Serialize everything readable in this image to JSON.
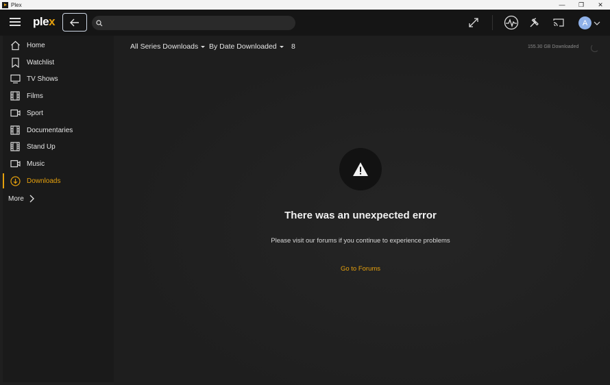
{
  "window": {
    "title": "Plex",
    "controls": [
      "minimize",
      "restore",
      "close"
    ]
  },
  "topbar": {
    "logo_text": "ple",
    "logo_accent": "x",
    "search": {
      "placeholder": "",
      "value": ""
    },
    "icons": [
      "menu-icon",
      "back-arrow-icon",
      "search-icon",
      "fullscreen-icon",
      "activity-icon",
      "settings-wrench-icon",
      "cast-icon",
      "chevron-down-icon"
    ],
    "avatar_letter": "A"
  },
  "sidebar": {
    "items": [
      {
        "label": "Home",
        "icon": "home-icon"
      },
      {
        "label": "Watchlist",
        "icon": "bookmark-icon"
      },
      {
        "label": "TV Shows",
        "icon": "tv-icon"
      },
      {
        "label": "Films",
        "icon": "film-icon"
      },
      {
        "label": "Sport",
        "icon": "video-camera-icon"
      },
      {
        "label": "Documentaries",
        "icon": "film-icon"
      },
      {
        "label": "Stand Up",
        "icon": "film-icon"
      },
      {
        "label": "Music",
        "icon": "video-camera-icon"
      },
      {
        "label": "Downloads",
        "icon": "download-icon",
        "active": true
      }
    ],
    "more_label": "More"
  },
  "toolbar": {
    "filter_label": "All Series Downloads",
    "sort_label": "By Date Downloaded",
    "count": "8",
    "downloaded_size": "155.30 GB Downloaded"
  },
  "error": {
    "title": "There was an unexpected error",
    "message": "Please visit our forums if you continue to experience problems",
    "link_label": "Go to Forums"
  },
  "colors": {
    "accent": "#e5a00d",
    "background": "#1f1f1f",
    "topbar": "#151515",
    "sidebar": "#1a1a1a"
  }
}
